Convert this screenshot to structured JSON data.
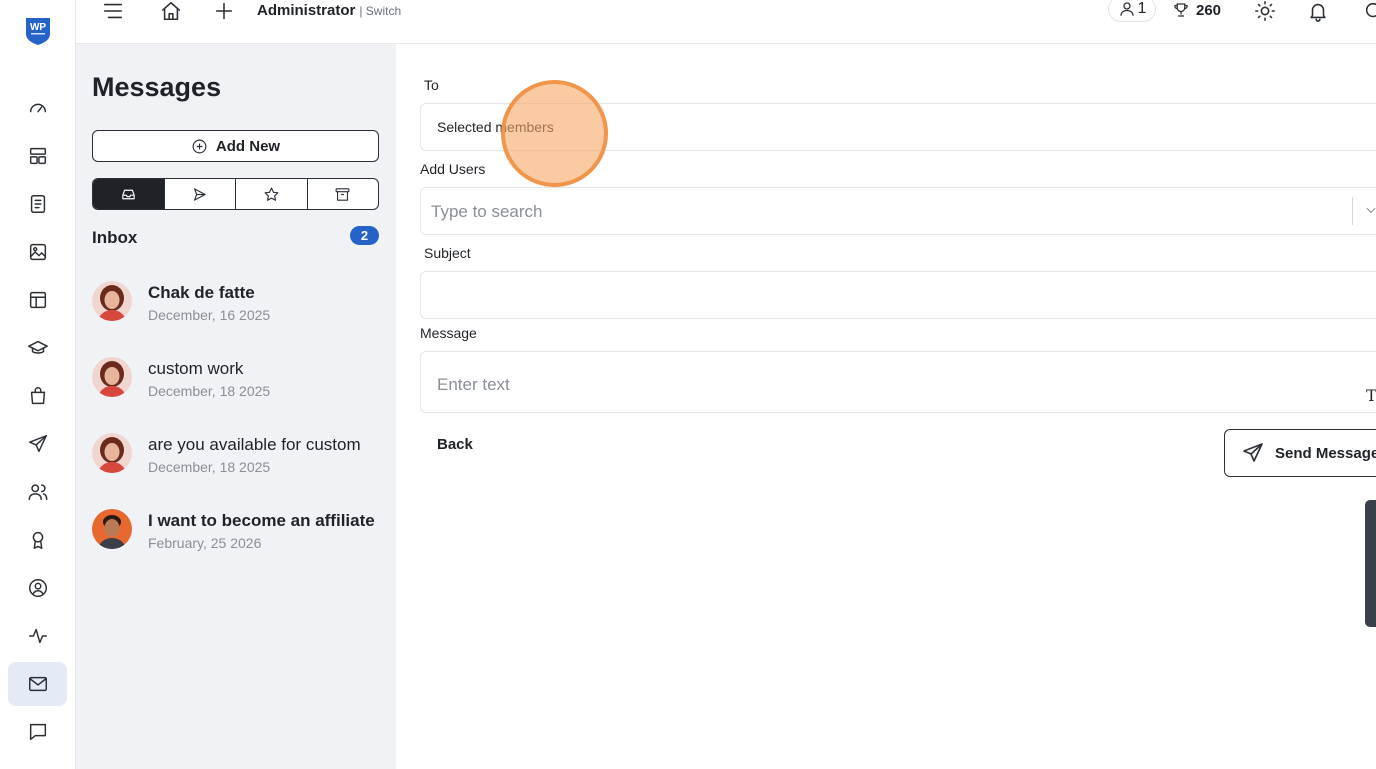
{
  "app": {
    "logo_text": "WP",
    "brand_color": "#2563c9"
  },
  "rail": {
    "items": [
      {
        "name": "dashboard-icon",
        "active": false
      },
      {
        "name": "layout-icon",
        "active": false
      },
      {
        "name": "notebook-icon",
        "active": false
      },
      {
        "name": "image-icon",
        "active": false
      },
      {
        "name": "table-icon",
        "active": false
      },
      {
        "name": "graduation-cap-icon",
        "active": false
      },
      {
        "name": "shopping-bag-icon",
        "active": false
      },
      {
        "name": "paper-plane-icon",
        "active": false
      },
      {
        "name": "users-icon",
        "active": false
      },
      {
        "name": "badge-icon",
        "active": false
      },
      {
        "name": "user-circle-icon",
        "active": false
      },
      {
        "name": "activity-icon",
        "active": false
      },
      {
        "name": "mail-icon",
        "active": true
      },
      {
        "name": "chat-icon",
        "active": false
      }
    ]
  },
  "topbar": {
    "user_name": "Administrator",
    "switch_label": "| Switch",
    "member_count": "1",
    "points": "260"
  },
  "messages": {
    "title": "Messages",
    "add_new_label": "Add New",
    "folders": [
      "inbox-icon",
      "sent-icon",
      "star-icon",
      "archive-icon"
    ],
    "active_folder": 0,
    "inbox_label": "Inbox",
    "inbox_count": "2",
    "list": [
      {
        "subject": "Chak de fatte",
        "date": "December, 16 2025",
        "unread": true
      },
      {
        "subject": "custom work",
        "date": "December, 18 2025",
        "unread": false
      },
      {
        "subject": "are you available for custom",
        "date": "December, 18 2025",
        "unread": false
      },
      {
        "subject": "I want to become an affiliate",
        "date": "February, 25 2026",
        "unread": true
      }
    ]
  },
  "compose": {
    "to_label": "To",
    "to_value": "Selected members",
    "add_users_label": "Add Users",
    "add_users_placeholder": "Type to search",
    "subject_label": "Subject",
    "subject_value": "",
    "message_label": "Message",
    "message_placeholder": "Enter text",
    "format_icon_glyph": "T",
    "back_label": "Back",
    "send_label": "Send Message"
  }
}
